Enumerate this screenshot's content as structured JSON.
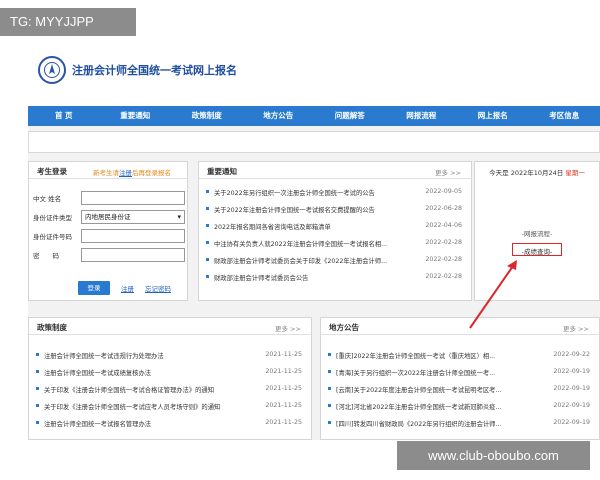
{
  "overlay": {
    "tag": "TG: MYYJJPP",
    "watermark": "www.club-oboubo.com"
  },
  "header": {
    "title": "注册会计师全国统一考试网上报名",
    "logo_icon": "cicpa-logo-icon"
  },
  "nav": {
    "items": [
      "首 页",
      "重要通知",
      "政策制度",
      "地方公告",
      "问题解答",
      "网报流程",
      "网上报名",
      "考区信息"
    ]
  },
  "login": {
    "title": "考生登录",
    "hint_pre": "新考生请",
    "hint_link": "注册",
    "hint_post": "后再登录报名",
    "name_label": "中文 姓名",
    "idtype_label": "身份证件类型",
    "idtype_value": "内地居民身份证",
    "idnum_label": "身份证件号码",
    "password_label": "密　　码",
    "login_button": "登录",
    "register_link": "注册",
    "forgot_link": "忘记密码"
  },
  "notices": {
    "title": "重要通知",
    "more": "更多 >>",
    "items": [
      {
        "text": "关于2022年另行组织一次注册会计师全国统一考试的公告",
        "date": "2022-09-05"
      },
      {
        "text": "关于2022年注册会计师全国统一考试报名交费提醒的公告",
        "date": "2022-06-28"
      },
      {
        "text": "2022年报名期间各省咨询电话及邮箱清单",
        "date": "2022-04-06"
      },
      {
        "text": "中注协有关负责人就2022年注册会计师全国统一考试报名相...",
        "date": "2022-02-28"
      },
      {
        "text": "财政部注册会计师考试委员会关于印发《2022年注册会计师...",
        "date": "2022-02-28"
      },
      {
        "text": "财政部注册会计师考试委员会公告",
        "date": "2022-02-28"
      }
    ]
  },
  "today": {
    "prefix": "今天是 2022年10月24日",
    "weekday": "星期一",
    "flow_link": "-网报流程-",
    "score_link": "-成绩查询-"
  },
  "policy": {
    "title": "政策制度",
    "more": "更多 >>",
    "items": [
      {
        "text": "注册会计师全国统一考试违规行为处理办法",
        "date": "2021-11-25"
      },
      {
        "text": "注册会计师全国统一考试成绩复核办法",
        "date": "2021-11-25"
      },
      {
        "text": "关于印发《注册会计师全国统一考试合格证管理办法》的通知",
        "date": "2021-11-25"
      },
      {
        "text": "关于印发《注册会计师全国统一考试应考人员考场守则》的通知",
        "date": "2021-11-25"
      },
      {
        "text": "注册会计师全国统一考试报名管理办法",
        "date": "2021-11-25"
      }
    ]
  },
  "local": {
    "title": "地方公告",
    "more": "更多 >>",
    "items": [
      {
        "text": "[重庆]2022年注册会计师全国统一考试（重庆地区）相...",
        "date": "2022-09-22"
      },
      {
        "text": "[青海]关于另行组织一次2022年注册会计师全国统一考...",
        "date": "2022-09-19"
      },
      {
        "text": "[云南]关于2022年度注册会计师全国统一考试昆明考区考...",
        "date": "2022-09-19"
      },
      {
        "text": "[河北]河北省2022年注册会计师全国统一考试新冠肺炎疫...",
        "date": "2022-09-19"
      },
      {
        "text": "[四川]转发四川省财政局《2022年另行组织的注册会计师...",
        "date": "2022-09-19"
      }
    ]
  },
  "colors": {
    "nav": "#2a7bd0",
    "title": "#1f4ea0",
    "accent_orange": "#e58a1f",
    "highlight_red": "#d9272d"
  }
}
